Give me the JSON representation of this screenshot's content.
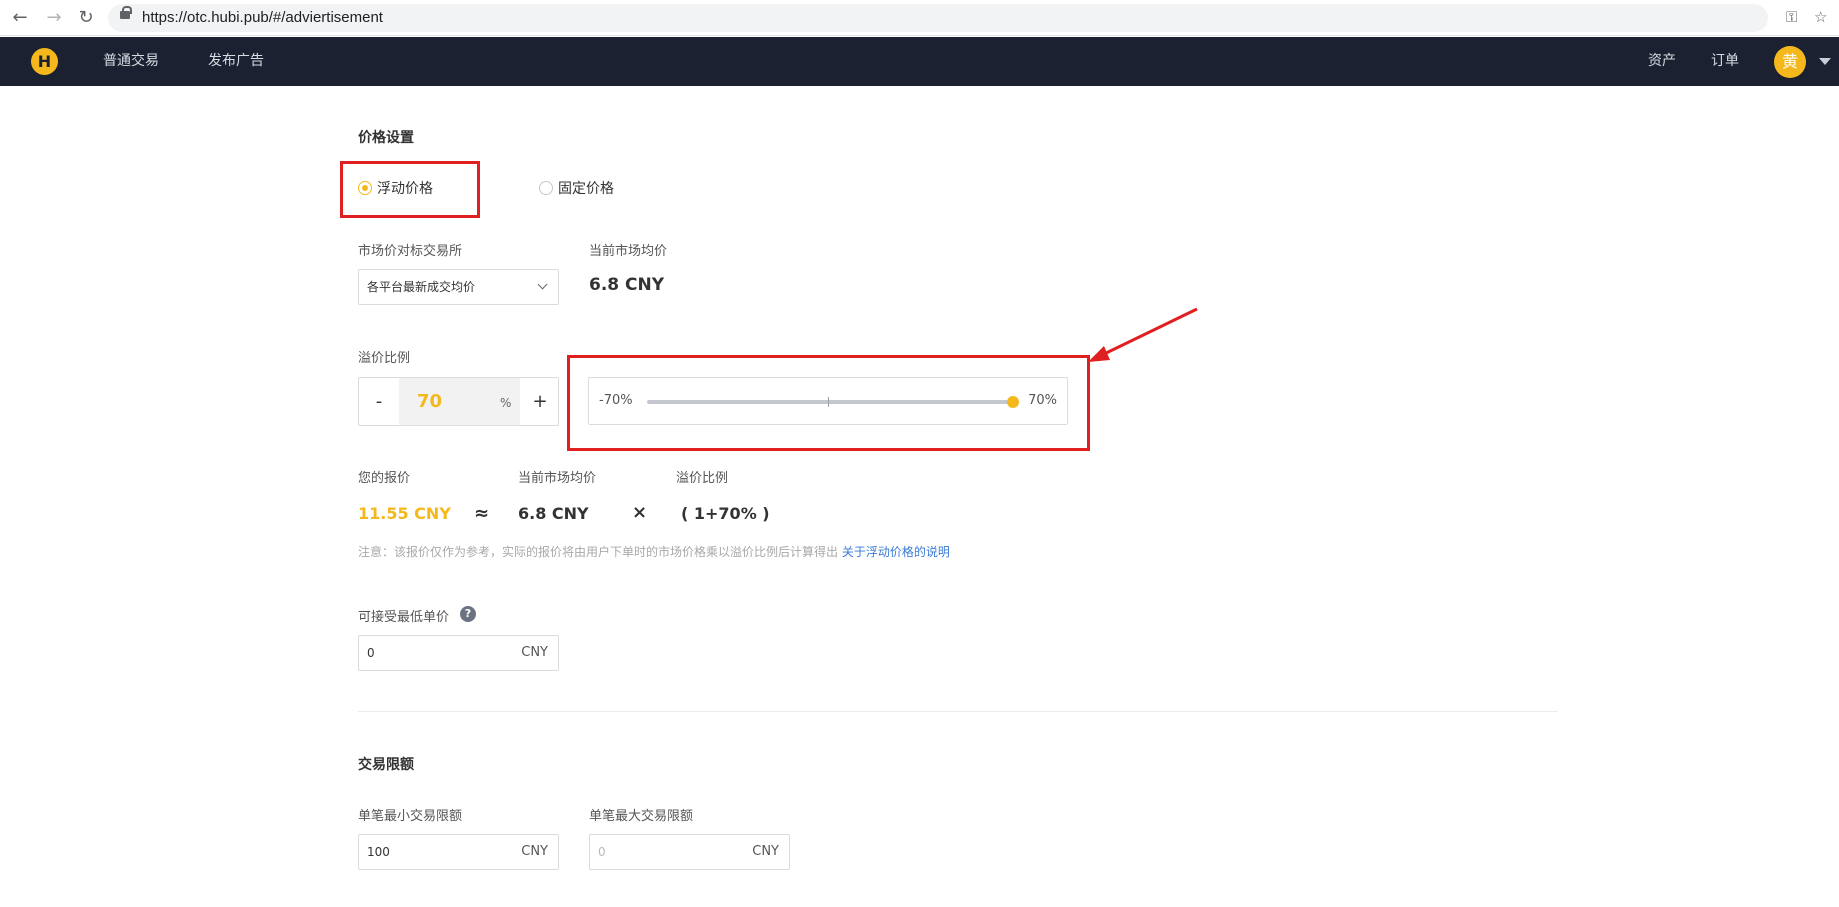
{
  "browser": {
    "url": "https://otc.hubi.pub/#/adviertisement"
  },
  "header": {
    "logo_glyph": "H",
    "nav": [
      "普通交易",
      "发布广告"
    ],
    "right_links": [
      "资产",
      "订单"
    ],
    "avatar_char": "黄"
  },
  "price_settings": {
    "title": "价格设置",
    "radio_floating": "浮动价格",
    "radio_fixed": "固定价格",
    "selected_radio": "浮动价格",
    "exchange_label": "市场价对标交易所",
    "exchange_value": "各平台最新成交均价",
    "market_avg_label": "当前市场均价",
    "market_avg_value": "6.8 CNY",
    "premium_label": "溢价比例",
    "stepper_minus": "-",
    "stepper_value": "70",
    "stepper_unit": "%",
    "stepper_plus": "+",
    "slider_min_label": "-70%",
    "slider_max_label": "70%",
    "slider_min": -70,
    "slider_max": 70,
    "slider_value": 70,
    "formula": {
      "your_price_label": "您的报价",
      "your_price_value": "11.55 CNY",
      "approx": "≈",
      "market_label": "当前市场均价",
      "market_value": "6.8 CNY",
      "times": "×",
      "premium_label": "溢价比例",
      "premium_value": "( 1+70% )"
    },
    "notice_text": "注意：该报价仅作为参考，实际的报价将由用户下单时的市场价格乘以溢价比例后计算得出",
    "notice_link": "关于浮动价格的说明",
    "min_price_label": "可接受最低单价",
    "min_price_help": "?",
    "min_price_value": "0",
    "min_price_unit": "CNY"
  },
  "trade_limits": {
    "title": "交易限额",
    "min_label": "单笔最小交易限额",
    "min_value": "100",
    "min_unit": "CNY",
    "max_label": "单笔最大交易限额",
    "max_placeholder": "0",
    "max_unit": "CNY"
  },
  "colors": {
    "accent": "#f5b81c",
    "header_bg": "#1b2130",
    "annotation_red": "#e02020",
    "link": "#3a7bd5"
  }
}
